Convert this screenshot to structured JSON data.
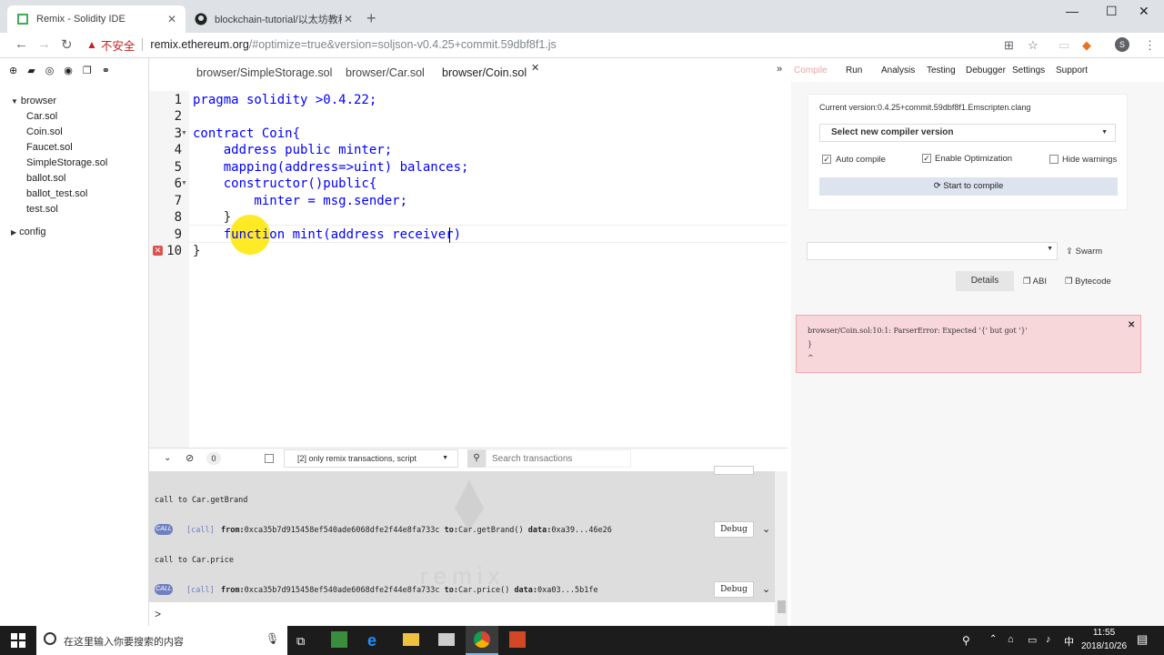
{
  "browser": {
    "tabs": [
      {
        "label": "Remix - Solidity IDE",
        "active": true
      },
      {
        "label": "blockchain-tutorial/以太坊教程",
        "active": false
      }
    ],
    "insecure_label": "不安全",
    "url_host": "remix.ethereum.org",
    "url_rest": "/#optimize=true&version=soljson-v0.4.25+commit.59dbf8f1.js",
    "profile_initial": "S"
  },
  "file_explorer": {
    "root_folder": "browser",
    "files": [
      "Car.sol",
      "Coin.sol",
      "Faucet.sol",
      "SimpleStorage.sol",
      "ballot.sol",
      "ballot_test.sol",
      "test.sol"
    ],
    "other_folder": "config"
  },
  "editor": {
    "tabs": [
      "browser/SimpleStorage.sol",
      "browser/Car.sol",
      "browser/Coin.sol"
    ],
    "active_tab": "browser/Coin.sol",
    "line_numbers": [
      "1",
      "2",
      "3",
      "4",
      "5",
      "6",
      "7",
      "8",
      "9",
      "10"
    ],
    "code_lines": [
      "pragma solidity >0.4.22;",
      "",
      "contract Coin{",
      "    address public minter;",
      "    mapping(address=>uint) balances;",
      "    constructor()public{",
      "        minter = msg.sender;",
      "    }",
      "    function mint(address receiver)",
      "}"
    ],
    "error_line": "10"
  },
  "terminal": {
    "filter_count": "0",
    "filter_label": "[2] only remix transactions, script",
    "search_placeholder": "Search transactions",
    "entries": [
      {
        "title": "call to Car.getBrand",
        "badge": "CALL",
        "kind": "[call]",
        "from_label": "from:",
        "from": "0xca35b7d915458ef540ade6068dfe2f44e8fa733c",
        "to_label": "to:",
        "to": "Car.getBrand()",
        "data_label": "data:",
        "data": "0xa39...46e26",
        "debug": "Debug"
      },
      {
        "title": "call to Car.price",
        "badge": "CALL",
        "kind": "[call]",
        "from_label": "from:",
        "from": "0xca35b7d915458ef540ade6068dfe2f44e8fa733c",
        "to_label": "to:",
        "to": "Car.price()",
        "data_label": "data:",
        "data": "0xa03...5b1fe",
        "debug": "Debug"
      }
    ],
    "prompt": ">",
    "watermark": "remix"
  },
  "right_panel": {
    "nav": [
      "Compile",
      "Run",
      "Analysis",
      "Testing",
      "Debugger",
      "Settings",
      "Support"
    ],
    "active_nav": "Compile",
    "current_version": "Current version:0.4.25+commit.59dbf8f1.Emscripten.clang",
    "select_version": "Select new compiler version",
    "options": [
      {
        "label": "Auto compile",
        "checked": true
      },
      {
        "label": "Enable Optimization",
        "checked": true
      },
      {
        "label": "Hide warnings",
        "checked": false
      }
    ],
    "start_compile": "Start to compile",
    "swarm": "Swarm",
    "details": "Details",
    "abi": "ABI",
    "bytecode": "Bytecode",
    "error_message": "browser/Coin.sol:10:1: ParserError: Expected '{' but got '}'\n}\n^"
  },
  "taskbar": {
    "search_placeholder": "在这里输入你要搜索的内容",
    "time": "11:55",
    "date": "2018/10/26"
  },
  "colors": {
    "error_bg": "#f8d7da",
    "keyword": "#0000ff",
    "highlight": "#ffe600"
  }
}
